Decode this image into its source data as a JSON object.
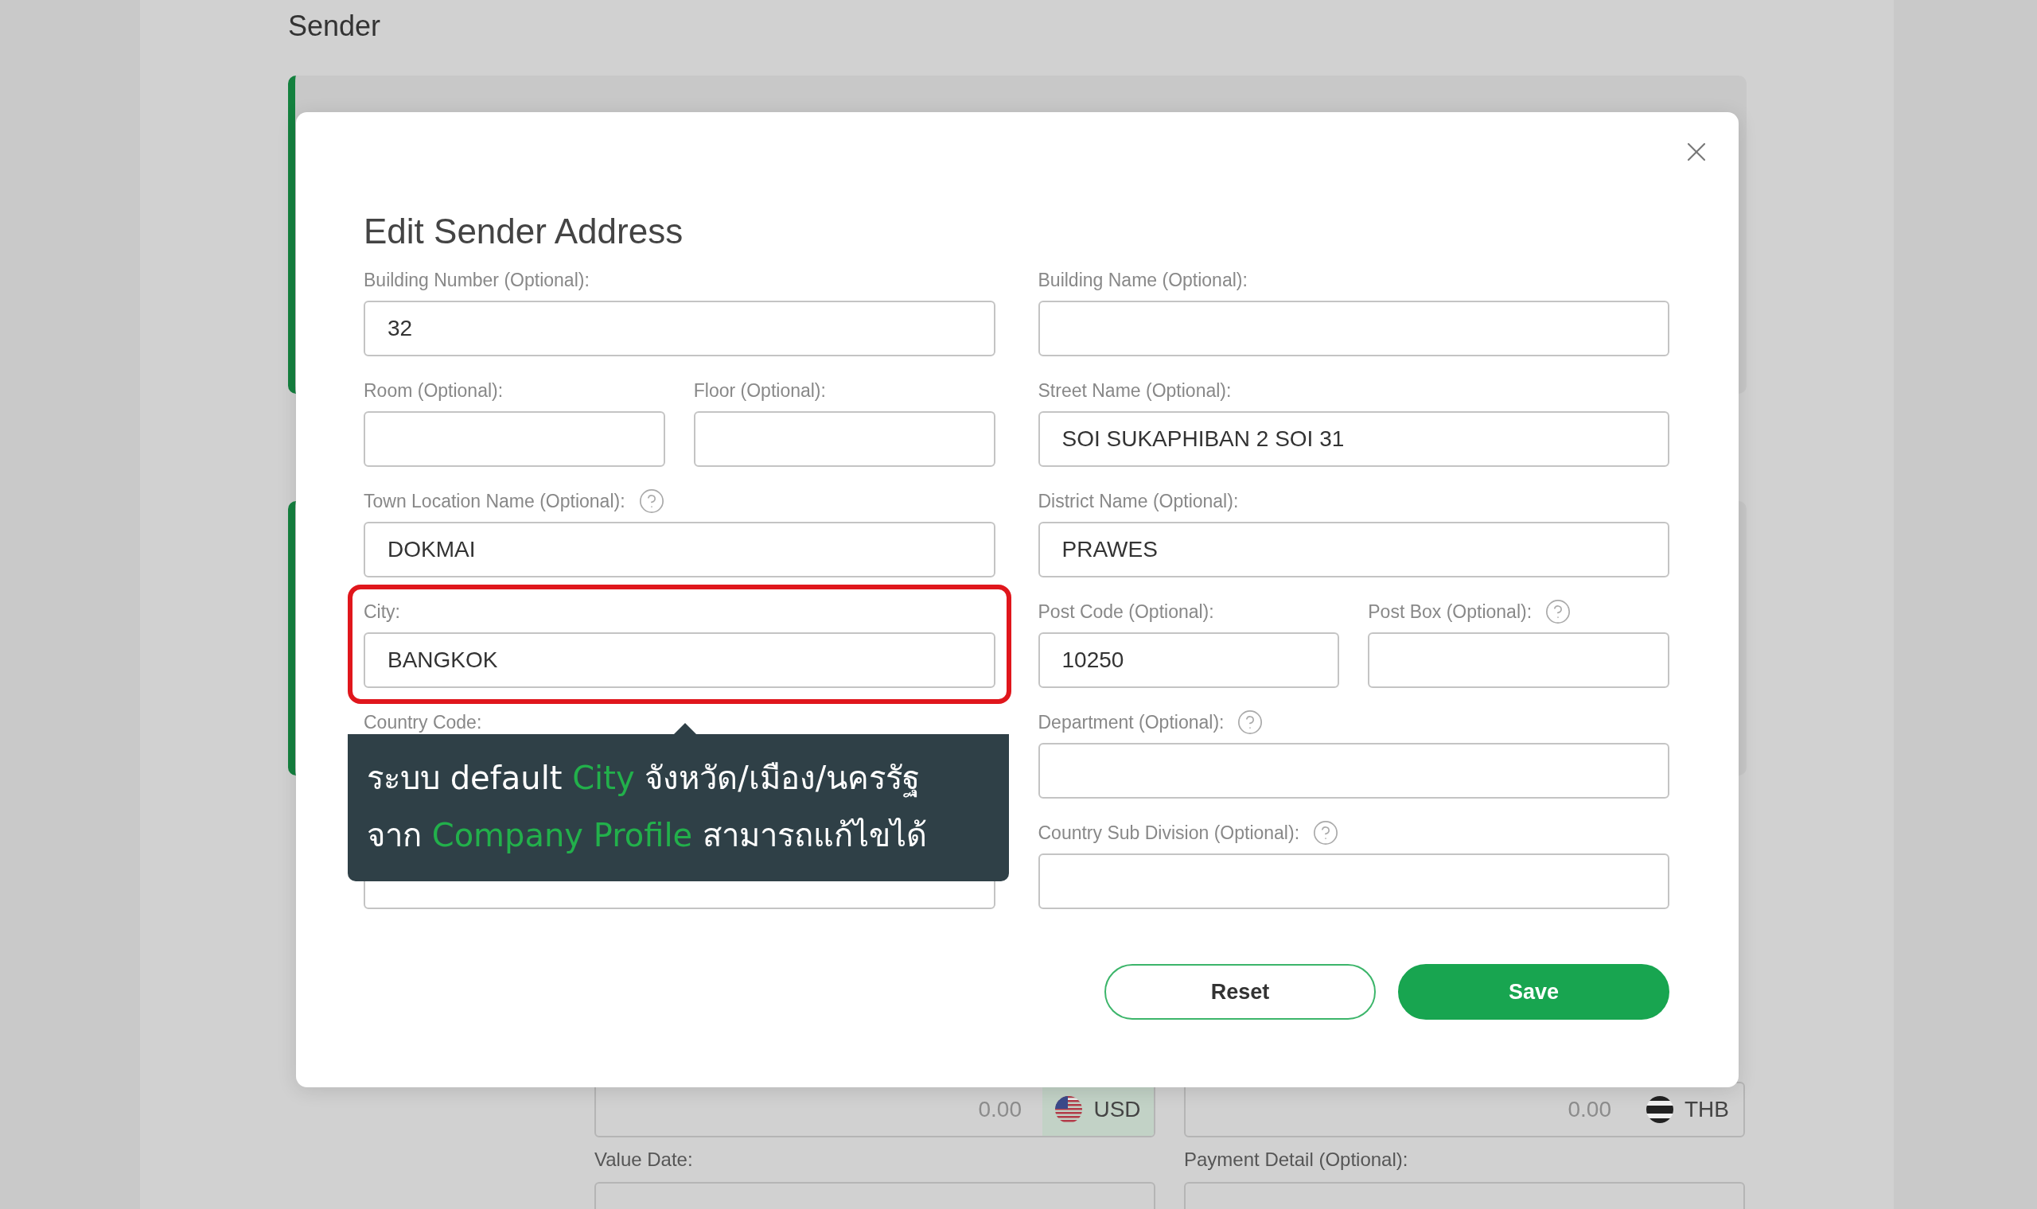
{
  "page": {
    "title": "Sender",
    "amounts": [
      {
        "placeholder": "0.00",
        "currency": "USD",
        "kind": "us",
        "active": true
      },
      {
        "placeholder": "0.00",
        "currency": "THB",
        "kind": "th",
        "active": false
      }
    ],
    "labels": [
      "Value Date:",
      "Payment Detail (Optional):"
    ]
  },
  "modal": {
    "title": "Edit Sender Address",
    "left_rows": [
      [
        {
          "kind": "field",
          "label": "Building Number (Optional):",
          "value": "32",
          "highlighted": false
        }
      ],
      [
        {
          "kind": "field",
          "label": "Room (Optional):",
          "highlighted": false
        },
        {
          "kind": "field",
          "label": "Floor (Optional):",
          "highlighted": false
        }
      ],
      [
        {
          "kind": "field",
          "label": "Town Location Name (Optional):",
          "value": "DOKMAI",
          "help": true,
          "highlighted": false
        }
      ],
      [
        {
          "kind": "field",
          "label": "City:",
          "value": "BANGKOK",
          "highlighted": true
        }
      ],
      [
        {
          "kind": "label",
          "label": "Country Code:"
        }
      ],
      [
        {
          "kind": "field",
          "highlighted": false
        }
      ]
    ],
    "right_rows": [
      [
        {
          "kind": "field",
          "label": "Building Name (Optional):",
          "highlighted": false
        }
      ],
      [
        {
          "kind": "field",
          "label": "Street Name (Optional):",
          "value": "SOI SUKAPHIBAN 2 SOI 31",
          "highlighted": false
        }
      ],
      [
        {
          "kind": "field",
          "label": "District Name (Optional):",
          "value": "PRAWES",
          "highlighted": false
        }
      ],
      [
        {
          "kind": "field",
          "label": "Post Code (Optional):",
          "value": "10250",
          "highlighted": false
        },
        {
          "kind": "field",
          "label": "Post Box (Optional):",
          "help": true,
          "highlighted": false
        }
      ],
      [
        {
          "kind": "field",
          "label": "Department (Optional):",
          "help": true,
          "highlighted": false
        }
      ],
      [
        {
          "kind": "field",
          "label": "Country Sub Division (Optional):",
          "help": true,
          "highlighted": false
        }
      ]
    ],
    "buttons": [
      {
        "label": "Reset",
        "kind": "outline"
      },
      {
        "label": "Save",
        "kind": "primary"
      }
    ]
  },
  "tooltip": {
    "lines": [
      [
        {
          "text": "ระบบ default ",
          "highlight": false
        },
        {
          "text": "City",
          "highlight": true
        },
        {
          "text": " จังหวัด/เมือง/นครรัฐ",
          "highlight": false
        }
      ],
      [
        {
          "text": "จาก ",
          "highlight": false
        },
        {
          "text": "Company Profile",
          "highlight": true
        },
        {
          "text": " สามารถแก้ไขได้",
          "highlight": false
        }
      ]
    ]
  }
}
